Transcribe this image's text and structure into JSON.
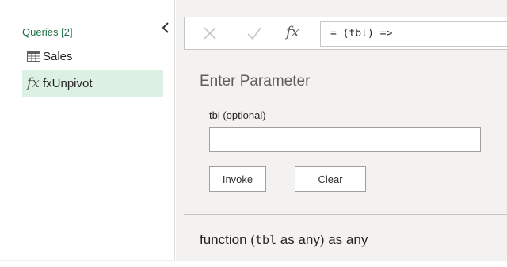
{
  "queries": {
    "header": "Queries [2]",
    "items": [
      {
        "label": "Sales",
        "icon": "table-icon",
        "selected": false
      },
      {
        "label": "fxUnpivot",
        "icon": "function-icon",
        "selected": true
      }
    ]
  },
  "formula_bar": {
    "fx_glyph": "fx",
    "formula": "= (tbl) =>"
  },
  "parameter_panel": {
    "title": "Enter Parameter",
    "param_label": "tbl (optional)",
    "param_value": "",
    "invoke_label": "Invoke",
    "clear_label": "Clear"
  },
  "signature": {
    "prefix": "function (",
    "code": "tbl",
    "suffix": " as any) as any"
  },
  "colors": {
    "accent": "#217346",
    "selected_bg": "#dcf1e4",
    "pane_bg": "#f3f2f1"
  }
}
